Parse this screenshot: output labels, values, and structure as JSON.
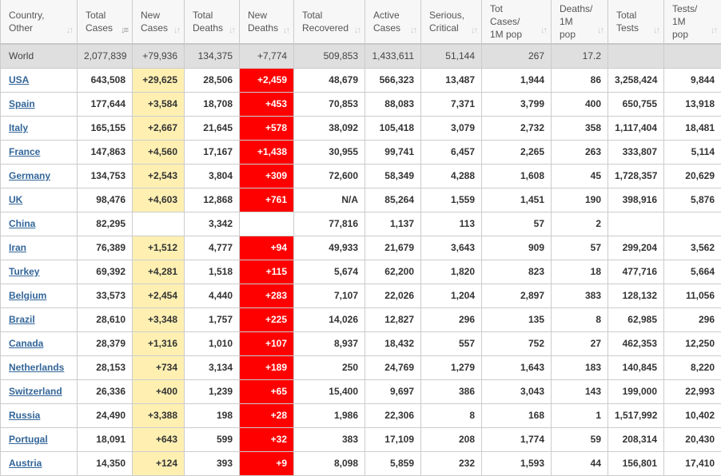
{
  "colors": {
    "new_cases_bg": "#fff0b2",
    "new_deaths_bg": "#ff0000",
    "world_row_bg": "#dfdfdf",
    "link": "#336699"
  },
  "headers": [
    {
      "line1": "Country,",
      "line2": "Other",
      "sort_icon": "sort-both-icon",
      "active": false
    },
    {
      "line1": "Total",
      "line2": "Cases",
      "sort_icon": "sort-desc-icon",
      "active": true
    },
    {
      "line1": "New",
      "line2": "Cases",
      "sort_icon": "sort-both-icon",
      "active": false
    },
    {
      "line1": "Total",
      "line2": "Deaths",
      "sort_icon": "sort-both-icon",
      "active": false
    },
    {
      "line1": "New",
      "line2": "Deaths",
      "sort_icon": "sort-both-icon",
      "active": false
    },
    {
      "line1": "Total",
      "line2": "Recovered",
      "sort_icon": "sort-both-icon",
      "active": false
    },
    {
      "line1": "Active",
      "line2": "Cases",
      "sort_icon": "sort-both-icon",
      "active": false
    },
    {
      "line1": "Serious,",
      "line2": "Critical",
      "sort_icon": "sort-both-icon",
      "active": false
    },
    {
      "line1": "Tot Cases/",
      "line2": "1M pop",
      "sort_icon": "sort-both-icon",
      "active": false
    },
    {
      "line1": "Deaths/",
      "line2": "1M pop",
      "sort_icon": "sort-both-icon",
      "active": false
    },
    {
      "line1": "Total",
      "line2": "Tests",
      "sort_icon": "sort-both-icon",
      "active": false
    },
    {
      "line1": "Tests/",
      "line2": "1M pop",
      "sort_icon": "sort-both-icon",
      "active": false
    }
  ],
  "world": {
    "country": "World",
    "total_cases": "2,077,839",
    "new_cases": "+79,936",
    "total_deaths": "134,375",
    "new_deaths": "+7,774",
    "total_recovered": "509,853",
    "active_cases": "1,433,611",
    "serious_critical": "51,144",
    "tot_cases_per_1m": "267",
    "deaths_per_1m": "17.2",
    "total_tests": "",
    "tests_per_1m": ""
  },
  "rows": [
    {
      "country": "USA",
      "total_cases": "643,508",
      "new_cases": "+29,625",
      "total_deaths": "28,506",
      "new_deaths": "+2,459",
      "total_recovered": "48,679",
      "active_cases": "566,323",
      "serious_critical": "13,487",
      "tot_cases_per_1m": "1,944",
      "deaths_per_1m": "86",
      "total_tests": "3,258,424",
      "tests_per_1m": "9,844"
    },
    {
      "country": "Spain",
      "total_cases": "177,644",
      "new_cases": "+3,584",
      "total_deaths": "18,708",
      "new_deaths": "+453",
      "total_recovered": "70,853",
      "active_cases": "88,083",
      "serious_critical": "7,371",
      "tot_cases_per_1m": "3,799",
      "deaths_per_1m": "400",
      "total_tests": "650,755",
      "tests_per_1m": "13,918"
    },
    {
      "country": "Italy",
      "total_cases": "165,155",
      "new_cases": "+2,667",
      "total_deaths": "21,645",
      "new_deaths": "+578",
      "total_recovered": "38,092",
      "active_cases": "105,418",
      "serious_critical": "3,079",
      "tot_cases_per_1m": "2,732",
      "deaths_per_1m": "358",
      "total_tests": "1,117,404",
      "tests_per_1m": "18,481"
    },
    {
      "country": "France",
      "total_cases": "147,863",
      "new_cases": "+4,560",
      "total_deaths": "17,167",
      "new_deaths": "+1,438",
      "total_recovered": "30,955",
      "active_cases": "99,741",
      "serious_critical": "6,457",
      "tot_cases_per_1m": "2,265",
      "deaths_per_1m": "263",
      "total_tests": "333,807",
      "tests_per_1m": "5,114"
    },
    {
      "country": "Germany",
      "total_cases": "134,753",
      "new_cases": "+2,543",
      "total_deaths": "3,804",
      "new_deaths": "+309",
      "total_recovered": "72,600",
      "active_cases": "58,349",
      "serious_critical": "4,288",
      "tot_cases_per_1m": "1,608",
      "deaths_per_1m": "45",
      "total_tests": "1,728,357",
      "tests_per_1m": "20,629"
    },
    {
      "country": "UK",
      "total_cases": "98,476",
      "new_cases": "+4,603",
      "total_deaths": "12,868",
      "new_deaths": "+761",
      "total_recovered": "N/A",
      "active_cases": "85,264",
      "serious_critical": "1,559",
      "tot_cases_per_1m": "1,451",
      "deaths_per_1m": "190",
      "total_tests": "398,916",
      "tests_per_1m": "5,876"
    },
    {
      "country": "China",
      "total_cases": "82,295",
      "new_cases": "",
      "total_deaths": "3,342",
      "new_deaths": "",
      "total_recovered": "77,816",
      "active_cases": "1,137",
      "serious_critical": "113",
      "tot_cases_per_1m": "57",
      "deaths_per_1m": "2",
      "total_tests": "",
      "tests_per_1m": ""
    },
    {
      "country": "Iran",
      "total_cases": "76,389",
      "new_cases": "+1,512",
      "total_deaths": "4,777",
      "new_deaths": "+94",
      "total_recovered": "49,933",
      "active_cases": "21,679",
      "serious_critical": "3,643",
      "tot_cases_per_1m": "909",
      "deaths_per_1m": "57",
      "total_tests": "299,204",
      "tests_per_1m": "3,562"
    },
    {
      "country": "Turkey",
      "total_cases": "69,392",
      "new_cases": "+4,281",
      "total_deaths": "1,518",
      "new_deaths": "+115",
      "total_recovered": "5,674",
      "active_cases": "62,200",
      "serious_critical": "1,820",
      "tot_cases_per_1m": "823",
      "deaths_per_1m": "18",
      "total_tests": "477,716",
      "tests_per_1m": "5,664"
    },
    {
      "country": "Belgium",
      "total_cases": "33,573",
      "new_cases": "+2,454",
      "total_deaths": "4,440",
      "new_deaths": "+283",
      "total_recovered": "7,107",
      "active_cases": "22,026",
      "serious_critical": "1,204",
      "tot_cases_per_1m": "2,897",
      "deaths_per_1m": "383",
      "total_tests": "128,132",
      "tests_per_1m": "11,056"
    },
    {
      "country": "Brazil",
      "total_cases": "28,610",
      "new_cases": "+3,348",
      "total_deaths": "1,757",
      "new_deaths": "+225",
      "total_recovered": "14,026",
      "active_cases": "12,827",
      "serious_critical": "296",
      "tot_cases_per_1m": "135",
      "deaths_per_1m": "8",
      "total_tests": "62,985",
      "tests_per_1m": "296"
    },
    {
      "country": "Canada",
      "total_cases": "28,379",
      "new_cases": "+1,316",
      "total_deaths": "1,010",
      "new_deaths": "+107",
      "total_recovered": "8,937",
      "active_cases": "18,432",
      "serious_critical": "557",
      "tot_cases_per_1m": "752",
      "deaths_per_1m": "27",
      "total_tests": "462,353",
      "tests_per_1m": "12,250"
    },
    {
      "country": "Netherlands",
      "total_cases": "28,153",
      "new_cases": "+734",
      "total_deaths": "3,134",
      "new_deaths": "+189",
      "total_recovered": "250",
      "active_cases": "24,769",
      "serious_critical": "1,279",
      "tot_cases_per_1m": "1,643",
      "deaths_per_1m": "183",
      "total_tests": "140,845",
      "tests_per_1m": "8,220"
    },
    {
      "country": "Switzerland",
      "total_cases": "26,336",
      "new_cases": "+400",
      "total_deaths": "1,239",
      "new_deaths": "+65",
      "total_recovered": "15,400",
      "active_cases": "9,697",
      "serious_critical": "386",
      "tot_cases_per_1m": "3,043",
      "deaths_per_1m": "143",
      "total_tests": "199,000",
      "tests_per_1m": "22,993"
    },
    {
      "country": "Russia",
      "total_cases": "24,490",
      "new_cases": "+3,388",
      "total_deaths": "198",
      "new_deaths": "+28",
      "total_recovered": "1,986",
      "active_cases": "22,306",
      "serious_critical": "8",
      "tot_cases_per_1m": "168",
      "deaths_per_1m": "1",
      "total_tests": "1,517,992",
      "tests_per_1m": "10,402"
    },
    {
      "country": "Portugal",
      "total_cases": "18,091",
      "new_cases": "+643",
      "total_deaths": "599",
      "new_deaths": "+32",
      "total_recovered": "383",
      "active_cases": "17,109",
      "serious_critical": "208",
      "tot_cases_per_1m": "1,774",
      "deaths_per_1m": "59",
      "total_tests": "208,314",
      "tests_per_1m": "20,430"
    },
    {
      "country": "Austria",
      "total_cases": "14,350",
      "new_cases": "+124",
      "total_deaths": "393",
      "new_deaths": "+9",
      "total_recovered": "8,098",
      "active_cases": "5,859",
      "serious_critical": "232",
      "tot_cases_per_1m": "1,593",
      "deaths_per_1m": "44",
      "total_tests": "156,801",
      "tests_per_1m": "17,410"
    }
  ]
}
